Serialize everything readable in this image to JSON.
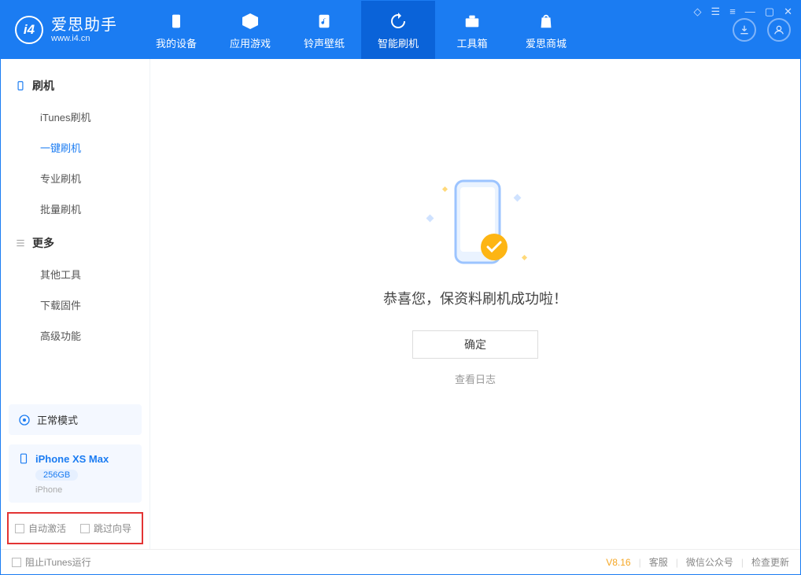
{
  "app": {
    "name_cn": "爱思助手",
    "name_en": "www.i4.cn"
  },
  "nav": {
    "device": "我的设备",
    "apps": "应用游戏",
    "ring": "铃声壁纸",
    "flash": "智能刷机",
    "tools": "工具箱",
    "store": "爱思商城"
  },
  "sidebar": {
    "group_flash": "刷机",
    "items_flash": [
      "iTunes刷机",
      "一键刷机",
      "专业刷机",
      "批量刷机"
    ],
    "group_more": "更多",
    "items_more": [
      "其他工具",
      "下载固件",
      "高级功能"
    ]
  },
  "mode": {
    "label": "正常模式"
  },
  "device": {
    "name": "iPhone XS Max",
    "capacity": "256GB",
    "type": "iPhone"
  },
  "options": {
    "auto_activate": "自动激活",
    "skip_guide": "跳过向导"
  },
  "main": {
    "success_msg": "恭喜您，保资料刷机成功啦！",
    "ok": "确定",
    "view_log": "查看日志"
  },
  "footer": {
    "block_itunes": "阻止iTunes运行",
    "version": "V8.16",
    "support": "客服",
    "wechat": "微信公众号",
    "update": "检查更新"
  }
}
